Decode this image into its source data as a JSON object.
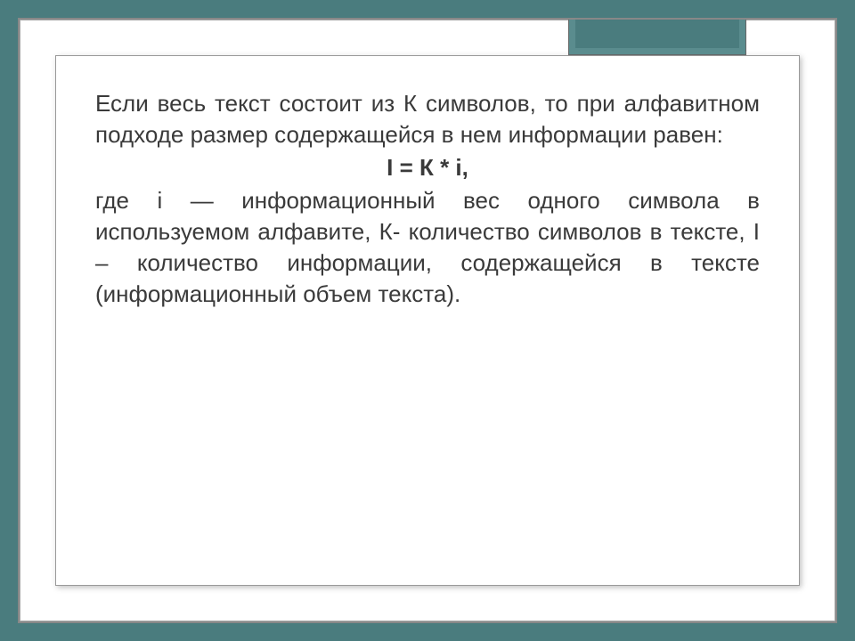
{
  "slide": {
    "paragraph1": "Если весь текст состоит из К символов, то при алфавитном подходе размер содержащейся в нем информации равен:",
    "formula": "I = К * i,",
    "paragraph2": "где i — информационный вес одного символа в используемом алфавите, К- количество символов в тексте, I – количество информации, содержащейся в тексте (информационный объем текста)."
  }
}
